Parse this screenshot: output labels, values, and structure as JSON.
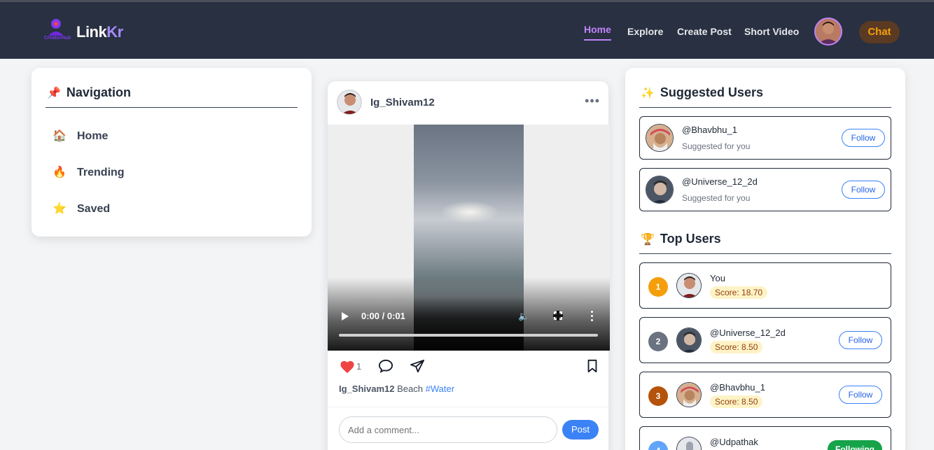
{
  "header": {
    "logo_caption": "CreatorHub",
    "brand_main": "Link",
    "brand_accent": "Kr",
    "nav": [
      "Home",
      "Explore",
      "Create Post",
      "Short Video"
    ],
    "active_nav": "Home",
    "chat_label": "Chat"
  },
  "left_nav": {
    "title": "Navigation",
    "title_icon": "pushpin-icon",
    "items": [
      {
        "label": "Home",
        "icon": "house-icon"
      },
      {
        "label": "Trending",
        "icon": "fire-icon"
      },
      {
        "label": "Saved",
        "icon": "star-icon"
      }
    ]
  },
  "post": {
    "username": "Ig_Shivam12",
    "video_time": "0:00 / 0:01",
    "likes": "1",
    "caption_user": "Ig_Shivam12",
    "caption_text": "Beach",
    "caption_tag": "#Water",
    "comment_placeholder": "Add a comment...",
    "post_label": "Post"
  },
  "suggested": {
    "title": "Suggested Users",
    "users": [
      {
        "handle": "@Bhavbhu_1",
        "sub": "Suggested for you",
        "action": "Follow"
      },
      {
        "handle": "@Universe_12_2d",
        "sub": "Suggested for you",
        "action": "Follow"
      }
    ]
  },
  "top_users": {
    "title": "Top Users",
    "users": [
      {
        "rank": "1",
        "name": "You",
        "score": "Score: 18.70",
        "action": "",
        "rank_color": "#f59e0b"
      },
      {
        "rank": "2",
        "name": "@Universe_12_2d",
        "score": "Score: 8.50",
        "action": "Follow",
        "rank_color": "#6b7280"
      },
      {
        "rank": "3",
        "name": "@Bhavbhu_1",
        "score": "Score: 8.50",
        "action": "Follow",
        "rank_color": "#b45309"
      },
      {
        "rank": "4",
        "name": "@Udpathak",
        "score": "",
        "action": "Following",
        "rank_color": "#60a5fa"
      }
    ]
  },
  "colors": {
    "header_bg": "#283041",
    "accent_purple": "#c084fc",
    "link_blue": "#3b82f6",
    "following_green": "#16a34a"
  }
}
